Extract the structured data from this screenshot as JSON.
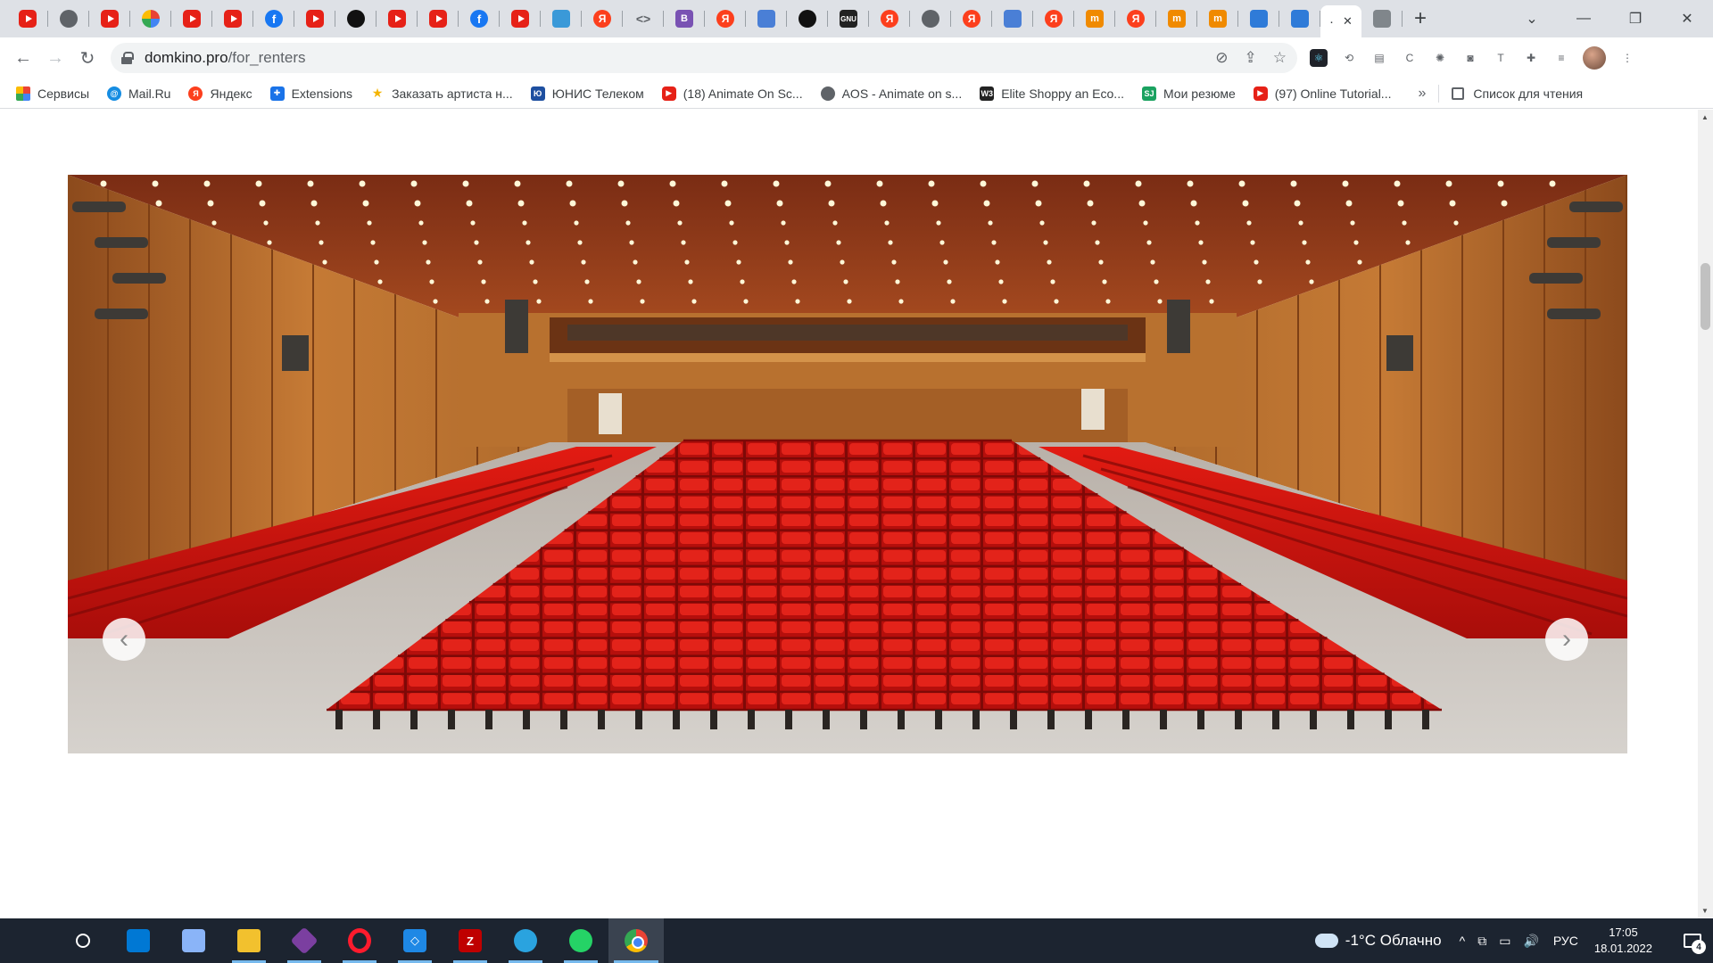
{
  "browser": {
    "tabs_favicons": [
      "youtube",
      "globe",
      "youtube",
      "multi",
      "youtube",
      "youtube",
      "facebook",
      "youtube",
      "github",
      "youtube",
      "youtube",
      "facebook",
      "youtube",
      "trello",
      "yandex",
      "code",
      "bootstrap",
      "yandex",
      "flag",
      "github",
      "dark",
      "yandex",
      "globe",
      "yandex",
      "flag",
      "yandex",
      "orange",
      "yandex",
      "orange",
      "orange",
      "pocketblue",
      "pocketblue"
    ],
    "yandex_glyph": "Я",
    "bootstrap_glyph": "B",
    "dark_glyph": "GNU",
    "orange_glyph": "m",
    "active_tab_glyph": "·",
    "active_tab_close": "✕",
    "new_tab": "+",
    "window_controls": {
      "tab_search": "⌄",
      "minimize": "—",
      "restore": "❐",
      "close": "✕"
    },
    "url": {
      "host": "domkino.pro",
      "path": "/for_renters"
    },
    "nav": {
      "back": "←",
      "forward": "→",
      "reload": "↻"
    },
    "omnibox_icons": {
      "eye_off": "⊘",
      "share": "⇪",
      "bookmark_star": "☆"
    },
    "extensions": [
      "react",
      "loop",
      "doc",
      "c",
      "sparkle",
      "camera",
      "T",
      "puzzle",
      "media",
      "avatar",
      "menu"
    ],
    "ext_glyphs": {
      "loop": "⟲",
      "doc": "▤",
      "c": "C",
      "sparkle": "✺",
      "camera": "◙",
      "T": "T",
      "puzzle": "✚",
      "media": "≡",
      "menu": "⋮"
    }
  },
  "bookmarks": {
    "items": [
      {
        "icon": "apps",
        "label": "Сервисы"
      },
      {
        "icon": "mail",
        "glyph": "@",
        "label": "Mail.Ru"
      },
      {
        "icon": "yandex",
        "glyph": "Я",
        "label": "Яндекс"
      },
      {
        "icon": "puzzle",
        "glyph": "✚",
        "label": "Extensions"
      },
      {
        "icon": "star",
        "glyph": "★",
        "label": "Заказать артиста н..."
      },
      {
        "icon": "unis",
        "glyph": "Ю",
        "label": "ЮНИС Телеком"
      },
      {
        "icon": "youtube",
        "glyph": "▶",
        "label": "(18) Animate On Sc..."
      },
      {
        "icon": "globe",
        "glyph": "",
        "label": "AOS - Animate on s..."
      },
      {
        "icon": "w3",
        "glyph": "W3",
        "label": "Elite Shoppy an Eco..."
      },
      {
        "icon": "sj",
        "glyph": "SJ",
        "label": "Мои резюме"
      },
      {
        "icon": "youtube",
        "glyph": "▶",
        "label": "(97) Online Tutorial..."
      }
    ],
    "more": "»",
    "reading_list": "Список для чтения"
  },
  "page": {
    "slider": {
      "prev_arrow": "‹",
      "next_arrow": "›"
    }
  },
  "scrollbar": {
    "up": "▲",
    "down": "▼"
  },
  "taskbar": {
    "apps": [
      "start",
      "search",
      "store",
      "photos",
      "folder",
      "git",
      "opera",
      "vscode",
      "filezilla",
      "telegram",
      "whatsapp",
      "chrome"
    ],
    "filezilla_glyph": "Z",
    "vscode_glyph": "◇",
    "weather": {
      "temp": "-1°C",
      "text": "Облачно"
    },
    "tray": {
      "chevron": "^",
      "device": "⧉",
      "battery": "▭",
      "volume": "🔊"
    },
    "lang": "РУС",
    "time": "17:05",
    "date": "18.01.2022",
    "notification_count": "4"
  },
  "colors": {
    "seat_red": "#c8120f",
    "wood": "#b86a2e",
    "ceiling": "#8e3a1d",
    "floor": "#c9c5c0"
  }
}
